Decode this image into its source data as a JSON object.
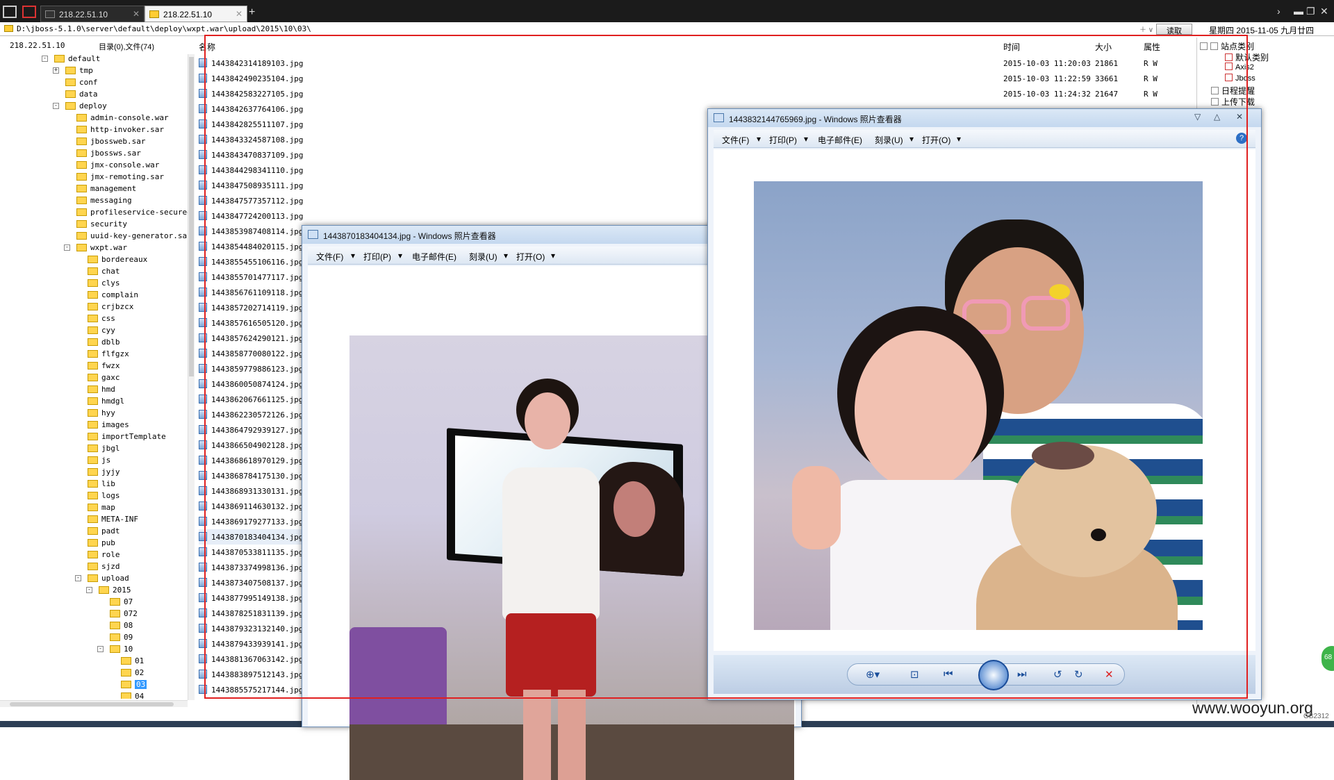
{
  "tabs": [
    {
      "label": "218.22.51.10",
      "active": false
    },
    {
      "label": "218.22.51.10",
      "active": true
    }
  ],
  "path": "D:\\jboss-5.1.0\\server\\default\\deploy\\wxpt.war\\upload\\2015\\10\\03\\",
  "read_button": "读取",
  "date_display": "星期四 2015-11-05 九月廿四",
  "tree_header": {
    "host": "218.22.51.10",
    "count": "目录(0),文件(74)"
  },
  "tree": [
    {
      "label": "default",
      "level": 0,
      "expander": "-"
    },
    {
      "label": "tmp",
      "level": 1,
      "expander": "+"
    },
    {
      "label": "conf",
      "level": 1
    },
    {
      "label": "data",
      "level": 1
    },
    {
      "label": "deploy",
      "level": 1,
      "expander": "-"
    },
    {
      "label": "admin-console.war",
      "level": 2
    },
    {
      "label": "http-invoker.sar",
      "level": 2
    },
    {
      "label": "jbossweb.sar",
      "level": 2
    },
    {
      "label": "jbossws.sar",
      "level": 2
    },
    {
      "label": "jmx-console.war",
      "level": 2
    },
    {
      "label": "jmx-remoting.sar",
      "level": 2
    },
    {
      "label": "management",
      "level": 2
    },
    {
      "label": "messaging",
      "level": 2
    },
    {
      "label": "profileservice-secured",
      "level": 2
    },
    {
      "label": "security",
      "level": 2
    },
    {
      "label": "uuid-key-generator.sar",
      "level": 2
    },
    {
      "label": "wxpt.war",
      "level": 2,
      "expander": "-"
    },
    {
      "label": "bordereaux",
      "level": 3
    },
    {
      "label": "chat",
      "level": 3
    },
    {
      "label": "clys",
      "level": 3
    },
    {
      "label": "complain",
      "level": 3
    },
    {
      "label": "crjbzcx",
      "level": 3
    },
    {
      "label": "css",
      "level": 3
    },
    {
      "label": "cyy",
      "level": 3
    },
    {
      "label": "dblb",
      "level": 3
    },
    {
      "label": "flfgzx",
      "level": 3
    },
    {
      "label": "fwzx",
      "level": 3
    },
    {
      "label": "gaxc",
      "level": 3
    },
    {
      "label": "hmd",
      "level": 3
    },
    {
      "label": "hmdgl",
      "level": 3
    },
    {
      "label": "hyy",
      "level": 3
    },
    {
      "label": "images",
      "level": 3
    },
    {
      "label": "importTemplate",
      "level": 3
    },
    {
      "label": "jbgl",
      "level": 3
    },
    {
      "label": "js",
      "level": 3
    },
    {
      "label": "jyjy",
      "level": 3
    },
    {
      "label": "lib",
      "level": 3
    },
    {
      "label": "logs",
      "level": 3
    },
    {
      "label": "map",
      "level": 3
    },
    {
      "label": "META-INF",
      "level": 3
    },
    {
      "label": "padt",
      "level": 3
    },
    {
      "label": "pub",
      "level": 3
    },
    {
      "label": "role",
      "level": 3
    },
    {
      "label": "sjzd",
      "level": 3
    },
    {
      "label": "upload",
      "level": 3,
      "expander": "-"
    },
    {
      "label": "2015",
      "level": 4,
      "expander": "-"
    },
    {
      "label": "07",
      "level": 5
    },
    {
      "label": "072",
      "level": 5
    },
    {
      "label": "08",
      "level": 5
    },
    {
      "label": "09",
      "level": 5
    },
    {
      "label": "10",
      "level": 5,
      "expander": "-"
    },
    {
      "label": "01",
      "level": 6
    },
    {
      "label": "02",
      "level": 6
    },
    {
      "label": "03",
      "level": 6,
      "selected": true
    },
    {
      "label": "04",
      "level": 6
    }
  ],
  "columns": {
    "name": "名称",
    "time": "时间",
    "size": "大小",
    "attr": "属性"
  },
  "files": [
    {
      "name": "1443842314189103.jpg",
      "time": "2015-10-03 11:20:03",
      "size": "21861",
      "attr": "R W"
    },
    {
      "name": "1443842490235104.jpg",
      "time": "2015-10-03 11:22:59",
      "size": "33661",
      "attr": "R W"
    },
    {
      "name": "1443842583227105.jpg",
      "time": "2015-10-03 11:24:32",
      "size": "21647",
      "attr": "R W"
    },
    {
      "name": "1443842637764106.jpg"
    },
    {
      "name": "1443842825511107.jpg"
    },
    {
      "name": "1443843324587108.jpg"
    },
    {
      "name": "1443843470837109.jpg"
    },
    {
      "name": "1443844298341110.jpg"
    },
    {
      "name": "1443847508935111.jpg"
    },
    {
      "name": "1443847577357112.jpg"
    },
    {
      "name": "1443847724200113.jpg"
    },
    {
      "name": "1443853987408114.jpg"
    },
    {
      "name": "1443854484020115.jpg"
    },
    {
      "name": "1443855455106116.jpg"
    },
    {
      "name": "1443855701477117.jpg"
    },
    {
      "name": "1443856761109118.jpg"
    },
    {
      "name": "1443857202714119.jpg"
    },
    {
      "name": "1443857616505120.jpg"
    },
    {
      "name": "1443857624290121.jpg"
    },
    {
      "name": "1443858770080122.jpg"
    },
    {
      "name": "1443859779886123.jpg"
    },
    {
      "name": "1443860050874124.jpg"
    },
    {
      "name": "1443862067661125.jpg"
    },
    {
      "name": "1443862230572126.jpg"
    },
    {
      "name": "1443864792939127.jpg"
    },
    {
      "name": "1443866504902128.jpg"
    },
    {
      "name": "1443868618970129.jpg"
    },
    {
      "name": "1443868784175130.jpg"
    },
    {
      "name": "1443868931330131.jpg"
    },
    {
      "name": "1443869114630132.jpg"
    },
    {
      "name": "1443869179277133.jpg"
    },
    {
      "name": "1443870183404134.jpg",
      "selected": true
    },
    {
      "name": "1443870533811135.jpg"
    },
    {
      "name": "1443873374998136.jpg"
    },
    {
      "name": "1443873407508137.jpg"
    },
    {
      "name": "1443877995149138.jpg"
    },
    {
      "name": "1443878251831139.jpg"
    },
    {
      "name": "1443879323132140.jpg"
    },
    {
      "name": "1443879433939141.jpg"
    },
    {
      "name": "1443881367063142.jpg"
    },
    {
      "name": "1443883897512143.jpg"
    },
    {
      "name": "1443885575217144.jpg"
    }
  ],
  "right_panel": {
    "site_category": "站点类别",
    "default_category": "默认类别",
    "item_axis2": "Axis2",
    "item_jboss": "Jboss",
    "schedule": "日程提醒",
    "uploads": "上传下载"
  },
  "viewer1": {
    "title": "1443870183404134.jpg - Windows 照片查看器"
  },
  "viewer2": {
    "title": "1443832144765969.jpg - Windows 照片查看器"
  },
  "viewer_menu": {
    "file": "文件(F)",
    "print": "打印(P)",
    "email": "电子邮件(E)",
    "burn": "刻录(U)",
    "open": "打开(O)"
  },
  "watermark": "www.wooyun.org",
  "watermark_small": "GB2312",
  "badge": "68"
}
